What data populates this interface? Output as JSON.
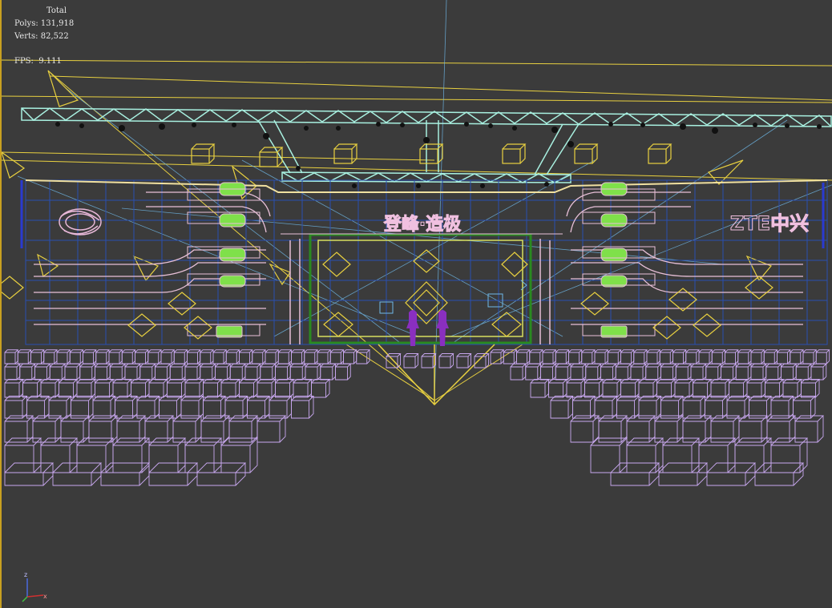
{
  "viewport": {
    "stats": {
      "total_label": "Total",
      "polys_label": "Polys:",
      "polys_value": "131,918",
      "verts_label": "Verts:",
      "verts_value": "82,522",
      "fps_label": "FPS:",
      "fps_value": "9.111"
    },
    "stage": {
      "left_sign": "",
      "center_sign": "登峰·造极",
      "right_sign": "ZTE中兴"
    },
    "axis": {
      "z": "z",
      "x": "x"
    },
    "colors": {
      "background": "#3b3b3b",
      "truss": "#a8f0e0",
      "light_helper": "#e8d040",
      "screen_wire": "#2a4fb0",
      "seat_wire": "#c9a8f0",
      "accent_green": "#7fe04a",
      "figure": "#8a2fc0"
    }
  }
}
